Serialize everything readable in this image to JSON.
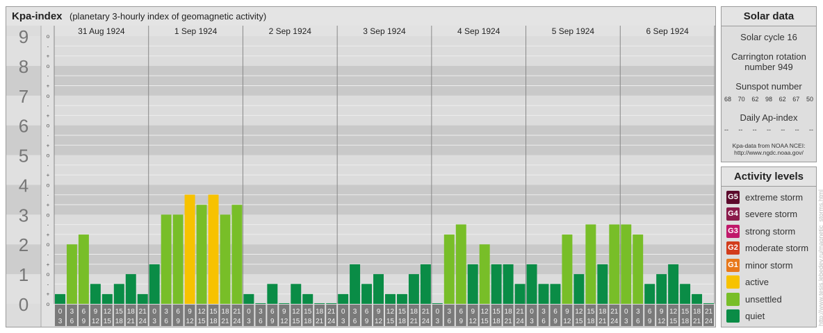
{
  "header": {
    "title": "Kpa-index",
    "subtitle": "(planetary 3-hourly index of geomagnetic activity)"
  },
  "chart_data": {
    "type": "bar",
    "ylim": [
      0,
      9
    ],
    "y_ticks": [
      "0",
      "1",
      "2",
      "3",
      "4",
      "5",
      "6",
      "7",
      "8",
      "9"
    ],
    "sub_tick_marks": [
      "+",
      "o",
      "-"
    ],
    "days": [
      "31 Aug 1924",
      "1 Sep 1924",
      "2 Sep 1924",
      "3 Sep 1924",
      "4 Sep 1924",
      "5 Sep 1924",
      "6 Sep 1924"
    ],
    "interval_start_hours": [
      "0",
      "3",
      "6",
      "9",
      "12",
      "15",
      "18",
      "21"
    ],
    "interval_end_hours": [
      "3",
      "6",
      "9",
      "12",
      "15",
      "18",
      "21",
      "24"
    ],
    "values": [
      [
        0.33,
        2.0,
        2.33,
        0.67,
        0.33,
        0.67,
        1.0,
        0.33
      ],
      [
        1.33,
        3.0,
        3.0,
        3.67,
        3.33,
        3.67,
        3.0,
        3.33
      ],
      [
        0.33,
        0.0,
        0.67,
        0.0,
        0.67,
        0.33,
        0.0,
        0.0
      ],
      [
        0.33,
        1.33,
        0.67,
        1.0,
        0.33,
        0.33,
        1.0,
        1.33
      ],
      [
        0.0,
        2.33,
        2.67,
        1.33,
        2.0,
        1.33,
        1.33,
        0.67
      ],
      [
        1.33,
        0.67,
        0.67,
        2.33,
        1.0,
        2.67,
        1.33,
        2.67
      ],
      [
        2.67,
        2.33,
        0.67,
        1.0,
        1.33,
        0.67,
        0.33,
        0.0
      ]
    ]
  },
  "colors": {
    "extreme": "#5c0a2c",
    "severe": "#8a1a4a",
    "strong": "#c0186a",
    "moderate": "#d23c1c",
    "minor": "#e8781a",
    "active": "#f7c200",
    "unsettled": "#78be28",
    "quiet": "#0a8c46"
  },
  "solar": {
    "title": "Solar data",
    "cycle": "Solar cycle 16",
    "carrington_line1": "Carrington rotation",
    "carrington_line2": "number 949",
    "sunspot_title": "Sunspot number",
    "sunspot_values": [
      "68",
      "70",
      "62",
      "98",
      "62",
      "67",
      "50"
    ],
    "ap_title": "Daily Ap-index",
    "ap_values": [
      "--",
      "--",
      "--",
      "--",
      "--",
      "--",
      "--"
    ],
    "source_line1": "Kpa-data from NOAA NCEI:",
    "source_line2": "http://www.ngdc.noaa.gov/"
  },
  "levels": {
    "title": "Activity levels",
    "items": [
      {
        "code": "G5",
        "label": "extreme storm",
        "color": "#5c0a2c"
      },
      {
        "code": "G4",
        "label": "severe storm",
        "color": "#8a1a4a"
      },
      {
        "code": "G3",
        "label": "strong storm",
        "color": "#c0186a"
      },
      {
        "code": "G2",
        "label": "moderate storm",
        "color": "#d23c1c"
      },
      {
        "code": "G1",
        "label": "minor storm",
        "color": "#e8781a"
      },
      {
        "code": "",
        "label": "active",
        "color": "#f7c200"
      },
      {
        "code": "",
        "label": "unsettled",
        "color": "#78be28"
      },
      {
        "code": "",
        "label": "quiet",
        "color": "#0a8c46"
      }
    ]
  },
  "watermark": "http://www.tesis.lebedev.ru/magnetic_storms.html"
}
